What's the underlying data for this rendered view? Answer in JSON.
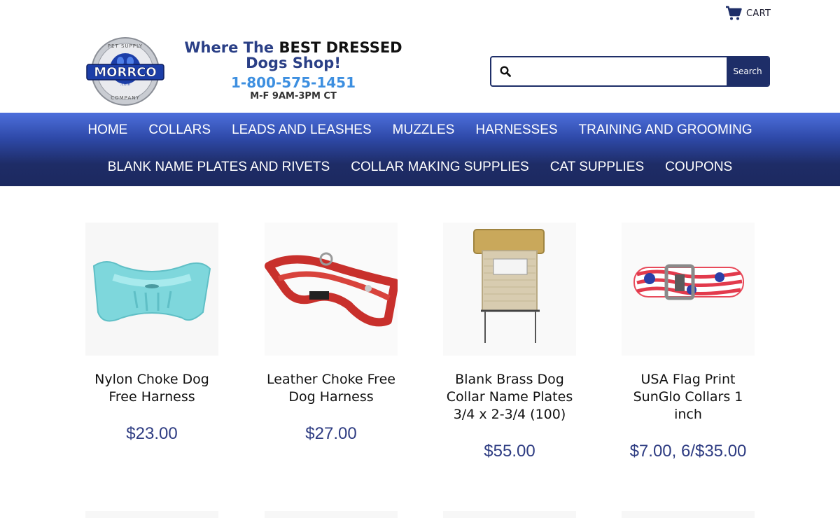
{
  "header": {
    "cart_label": "CART",
    "banner": {
      "logo_text": "MORRCO",
      "logo_ring_top": "PET SUPPLY",
      "logo_ring_bottom": "COMPANY",
      "logo_sub": ".com",
      "tagline_prefix": "Where The ",
      "tagline_bold": "BEST DRESSED",
      "tagline_line2": "Dogs Shop!",
      "phone": "1-800-575-1451",
      "hours": "M-F 9AM-3PM CT"
    },
    "search": {
      "placeholder": "",
      "button_label": "Search"
    }
  },
  "nav": {
    "row1": [
      "HOME",
      "COLLARS",
      "LEADS AND LEASHES",
      "MUZZLES",
      "HARNESSES",
      "TRAINING AND GROOMING"
    ],
    "row2": [
      "BLANK NAME PLATES AND RIVETS",
      "COLLAR MAKING SUPPLIES",
      "CAT SUPPLIES",
      "COUPONS"
    ]
  },
  "products": [
    {
      "name": "Nylon Choke Dog Free Harness",
      "price": "$23.00",
      "image_icon": "turquoise-mesh-harness"
    },
    {
      "name": "Leather Choke Free Dog Harness",
      "price": "$27.00",
      "image_icon": "red-leather-harness"
    },
    {
      "name": "Blank Brass Dog Collar Name Plates 3/4 x 2-3/4 (100)",
      "price": "$55.00",
      "image_icon": "brass-name-plates-bundle"
    },
    {
      "name": "USA Flag Print SunGlo Collars 1 inch",
      "price": "$7.00, 6/$35.00",
      "image_icon": "usa-flag-collar"
    }
  ],
  "colors": {
    "brand_navy": "#1e2e68",
    "nav_top": "#4d6fdc",
    "price": "#2e3c82",
    "phone": "#3d8fe0"
  }
}
